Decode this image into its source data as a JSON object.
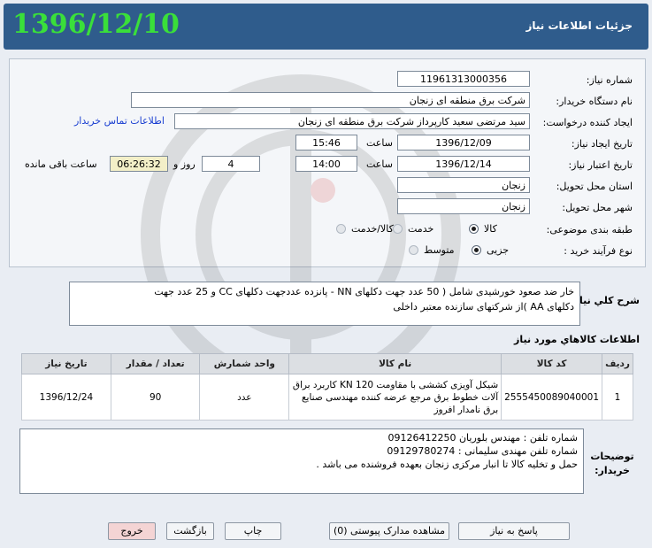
{
  "header": {
    "title": "جزئیات اطلاعات نیاز",
    "date": "1396/12/10"
  },
  "form": {
    "need_number_label": "شماره نیاز:",
    "need_number": "11961313000356",
    "buyer_org_label": "نام دستگاه خریدار:",
    "buyer_org": "شرکت برق منطقه ای زنجان",
    "requester_label": "ایجاد کننده درخواست:",
    "requester": "سید مرتضی  سعید کارپرداز شرکت برق منطقه ای زنجان",
    "contact_link": "اطلاعات تماس خریدار",
    "created_label": "تاریخ ایجاد نیاز:",
    "created_date": "1396/12/09",
    "time_label": "ساعت",
    "created_time": "15:46",
    "validity_label": "تاریخ اعتبار نیاز:",
    "validity_date": "1396/12/14",
    "validity_time": "14:00",
    "days_value": "4",
    "days_label": "روز و",
    "remaining_time": "06:26:32",
    "remaining_label": "ساعت باقی مانده",
    "province_label": "استان محل تحویل:",
    "province": "زنجان",
    "city_label": "شهر محل تحویل:",
    "city": "زنجان",
    "category_label": "طبقه بندی موضوعی:",
    "category_options": [
      "کالا",
      "خدمت",
      "کالا/خدمت"
    ],
    "process_label": "نوع فرآیند خرید :",
    "process_options": [
      "جزیی",
      "متوسط"
    ]
  },
  "description": {
    "label": "شرح کلي نیاز:",
    "line1": "خار ضد صعود خورشیدی شامل ( 50 عدد جهت دکلهای NN  -  پانزده عددجهت دکلهای CC   و 25 عدد جهت",
    "line2": "دکلهای AA )از شرکتهای سازنده معتبر داخلی"
  },
  "items": {
    "section_title": "اطلاعات کالاهاي مورد نیاز",
    "headers": [
      "ردیف",
      "کد کالا",
      "نام کالا",
      "واحد شمارش",
      "تعداد / مقدار",
      "تاریخ نیاز"
    ],
    "rows": [
      {
        "index": "1",
        "code": "2555450089040001",
        "name": "شیکل آویزی کششی با مقاومت KN 120 کاربرد براق آلات خطوط برق مرجع عرضه کننده مهندسی صنایع برق نامدار افروز",
        "unit": "عدد",
        "qty": "90",
        "date": "1396/12/24"
      }
    ]
  },
  "notes": {
    "label": "توضیحات خریدار:",
    "line1": "شماره تلفن : مهندس بلوریان 09126412250",
    "line2": "شماره تلفن مهندی سلیمانی : 09129780274",
    "line3": "حمل و تخلیه کالا تا انبار مرکزی زنجان بعهده فروشنده می باشد ."
  },
  "buttons": {
    "reply": "پاسخ به نیاز",
    "attachments": "مشاهده مدارک پیوستی (0)",
    "print": "چاپ",
    "back": "بازگشت",
    "exit": "خروج"
  }
}
